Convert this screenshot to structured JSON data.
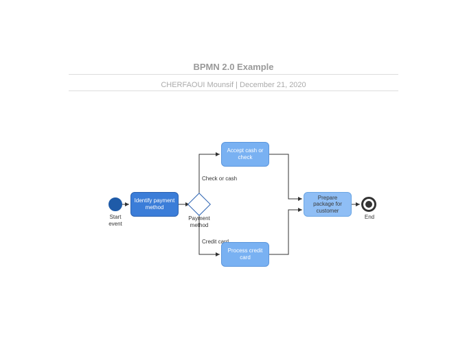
{
  "header": {
    "title": "BPMN 2.0 Example",
    "author": "CHERFAOUI Mounsif",
    "separator": "  |  ",
    "date": "December 21, 2020"
  },
  "diagram": {
    "start": {
      "label": "Start\nevent"
    },
    "task_identify": {
      "label": "Identify payment method"
    },
    "gateway": {
      "label": "Payment\nmethod"
    },
    "edge_top": {
      "label": "Check or cash"
    },
    "edge_bottom": {
      "label": "Credit card"
    },
    "task_cash": {
      "label": "Accept cash or check"
    },
    "task_credit": {
      "label": "Process credit card"
    },
    "task_prepare": {
      "label": "Prepare package for customer"
    },
    "end": {
      "label": "End"
    }
  }
}
